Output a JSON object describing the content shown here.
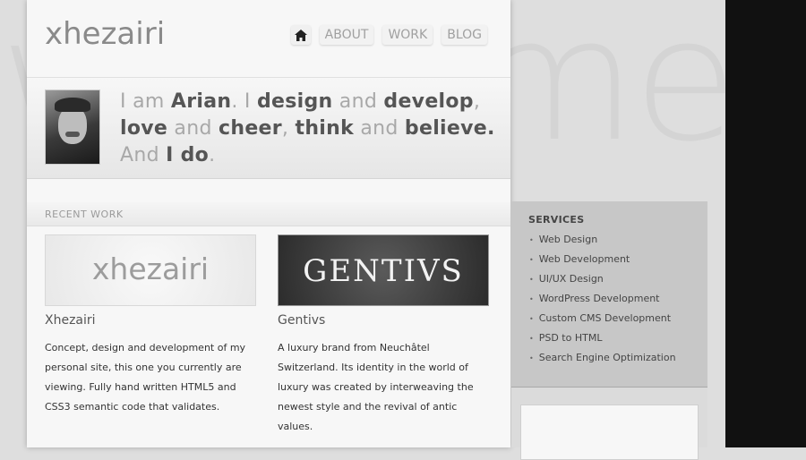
{
  "watermark": "welcome",
  "header": {
    "logo": "xhezairi",
    "nav": [
      {
        "label": "ABOUT"
      },
      {
        "label": "WORK"
      },
      {
        "label": "BLOG"
      }
    ]
  },
  "intro": {
    "parts": [
      {
        "t": "I am ",
        "b": false
      },
      {
        "t": "Arian",
        "b": true
      },
      {
        "t": ". I ",
        "b": false
      },
      {
        "t": "design",
        "b": true
      },
      {
        "t": " and ",
        "b": false
      },
      {
        "t": "develop",
        "b": true
      },
      {
        "t": ", ",
        "b": false
      },
      {
        "t": "love",
        "b": true
      },
      {
        "t": " and ",
        "b": false
      },
      {
        "t": "cheer",
        "b": true
      },
      {
        "t": ", ",
        "b": false
      },
      {
        "t": "think",
        "b": true
      },
      {
        "t": " and ",
        "b": false
      },
      {
        "t": "believe.",
        "b": true
      },
      {
        "t": " And ",
        "b": false
      },
      {
        "t": "I do",
        "b": true
      },
      {
        "t": ".",
        "b": false
      }
    ]
  },
  "recent_work": {
    "title": "RECENT WORK",
    "items": [
      {
        "thumb_text": "xhezairi",
        "title": "Xhezairi",
        "description": "Concept, design and development of my personal site, this one you currently are viewing. Fully hand written HTML5 and CSS3 semantic code that validates."
      },
      {
        "thumb_text": "GENTIVS",
        "title": "Gentivs",
        "description": "A luxury brand from Neuchâtel Switzerland. Its identity in the world of luxury was created by interweaving the newest style and the revival of antic values."
      }
    ]
  },
  "services": {
    "title": "SERVICES",
    "items": [
      "Web Design",
      "Web Development",
      "UI/UX Design",
      "WordPress Development",
      "Custom CMS Development",
      "PSD to HTML",
      "Search Engine Optimization"
    ]
  }
}
